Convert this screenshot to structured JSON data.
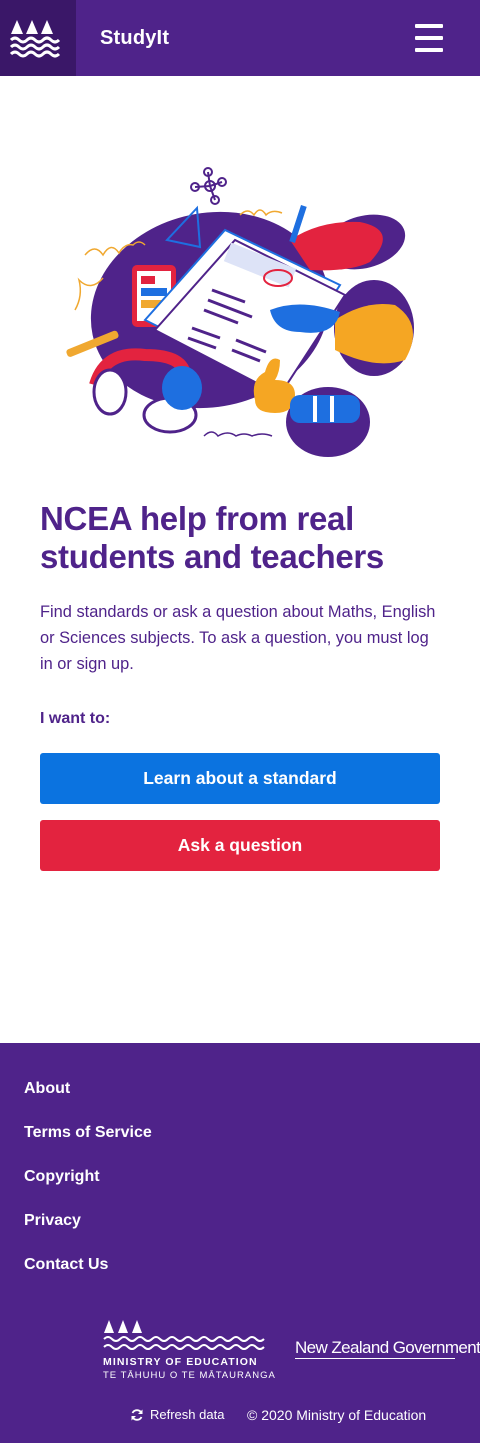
{
  "header": {
    "brand": "StudyIt",
    "logo_icon": "waves-mountains-logo-icon",
    "menu_icon": "hamburger-menu-icon"
  },
  "hero": {
    "illustration": "students-studying-illustration"
  },
  "main": {
    "headline": "NCEA help from real students and teachers",
    "lede": "Find standards or ask a question about Maths, English or Sciences subjects. To ask a question, you must log in or sign up.",
    "prompt": "I want to:",
    "learn_label": "Learn about a standard",
    "ask_label": "Ask a question"
  },
  "footer": {
    "links": [
      "About",
      "Terms of Service",
      "Copyright",
      "Privacy",
      "Contact Us"
    ],
    "ministry_line1": "MINISTRY OF EDUCATION",
    "ministry_line2": "TE TĀHUHU O TE MĀTAURANGA",
    "nz_government": "New Zealand Government",
    "refresh_label": "Refresh data",
    "copyright": "© 2020 Ministry of Education"
  },
  "colors": {
    "brand_purple": "#4f238a",
    "logo_purple": "#3a1768",
    "learn_blue": "#0b73e0",
    "ask_red": "#e3233f"
  }
}
